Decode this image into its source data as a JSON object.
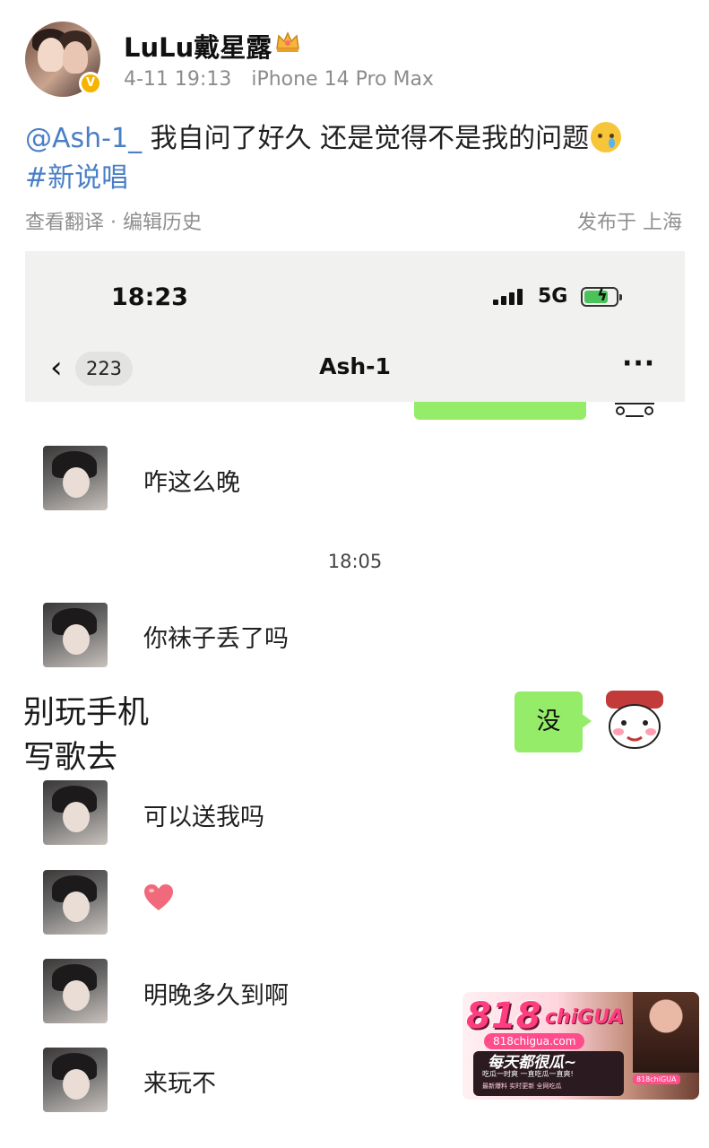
{
  "post": {
    "username": "LuLu戴星露",
    "timestamp": "4-11 19:13",
    "device": "iPhone 14 Pro Max",
    "mention": "@Ash-1_",
    "text": "我自问了好久 还是觉得不是我的问题",
    "hashtag": "#新说唱",
    "actions": "查看翻译 · 编辑历史",
    "location": "发布于 上海",
    "verified_badge": "V"
  },
  "screenshot": {
    "status": {
      "time": "18:23",
      "network": "5G",
      "battery_charging": true
    },
    "nav": {
      "back_count": "223",
      "title": "Ash-1",
      "more": "···"
    },
    "messages": [
      {
        "from": "other",
        "text": "咋这么晚"
      },
      {
        "time": "18:05"
      },
      {
        "from": "other",
        "text": "你袜子丢了吗"
      },
      {
        "from": "me",
        "text": "没"
      },
      {
        "from": "other",
        "text": "可以送我吗"
      },
      {
        "from": "other",
        "emoji": "heart"
      },
      {
        "from": "other",
        "text": "明晚多久到啊"
      },
      {
        "from": "other",
        "text": "来玩不"
      }
    ],
    "timestamp": "18:05",
    "caption_line1": "别玩手机",
    "caption_line2": "写歌去"
  },
  "watermark": {
    "brand": "818",
    "brand_suffix": "chiGUA",
    "url": "818chigua.com",
    "slogan": "每天都很瓜~",
    "sub": "吃瓜一时爽 一直吃瓜一直爽!",
    "tiny": "最新爆料 实时更新 全网吃瓜",
    "tag": "818chiGUA"
  }
}
